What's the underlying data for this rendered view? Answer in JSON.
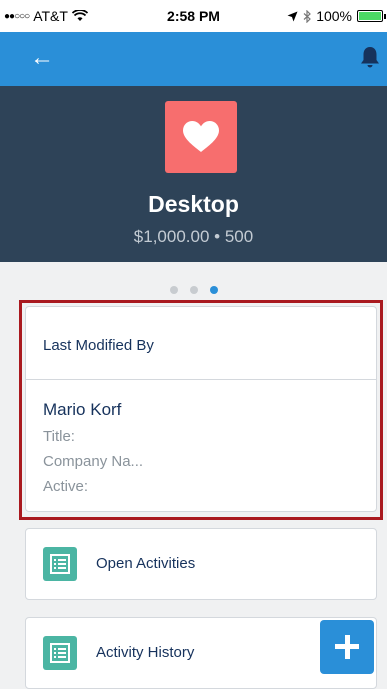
{
  "status_bar": {
    "carrier": "AT&T",
    "time": "2:58 PM",
    "battery": "100%",
    "battery_level": 1.0
  },
  "nav": {
    "back_label": "←"
  },
  "record": {
    "name": "Desktop",
    "meta": "$1,000.00 • 500",
    "icon": "heart-icon"
  },
  "pager": {
    "count": 3,
    "active_index": 2
  },
  "last_modified": {
    "header": "Last Modified By",
    "user_name": "Mario Korf",
    "fields": [
      "Title:",
      "Company Na...",
      "Active:"
    ]
  },
  "related_lists": [
    {
      "label": "Open Activities",
      "icon": "list-icon"
    },
    {
      "label": "Activity History",
      "icon": "list-icon"
    }
  ],
  "colors": {
    "nav": "#2a8fd8",
    "hero": "#2e4358",
    "tile": "#f76e6e",
    "list_icon": "#4bb5a3",
    "highlight": "#a9191f"
  }
}
